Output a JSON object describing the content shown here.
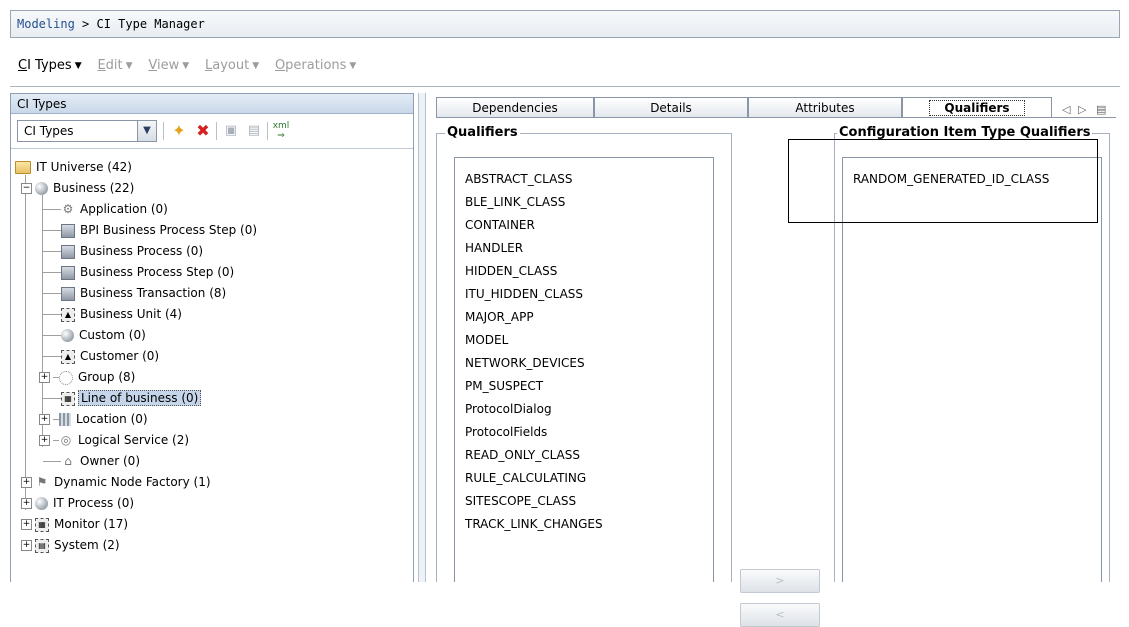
{
  "breadcrumb": {
    "root": "Modeling",
    "separator": " > ",
    "current": "CI Type Manager"
  },
  "menubar": [
    {
      "label_u": "C",
      "label_rest": "I Types",
      "state": "active"
    },
    {
      "label_u": "E",
      "label_rest": "dit",
      "state": "disabled"
    },
    {
      "label_u": "V",
      "label_rest": "iew",
      "state": "disabled"
    },
    {
      "label_u": "L",
      "label_rest": "ayout",
      "state": "disabled"
    },
    {
      "label_u": "O",
      "label_rest": "perations",
      "state": "disabled"
    }
  ],
  "left_panel": {
    "title": "CI Types",
    "select_value": "CI Types",
    "toolbar_icons": [
      "new-ci-type-icon",
      "delete-icon",
      "save-icon",
      "properties-icon",
      "export-xml-icon"
    ],
    "tree": [
      {
        "label": "IT Universe (42)",
        "icon": "folder-icon"
      },
      {
        "label": "Business (22)",
        "icon": "sphere-icon",
        "expander": "−"
      },
      {
        "label": "Application (0)",
        "icon": "gear-icon"
      },
      {
        "label": "BPI Business Process Step (0)",
        "icon": "process-step-icon"
      },
      {
        "label": "Business Process (0)",
        "icon": "document-icon"
      },
      {
        "label": "Business Process Step (0)",
        "icon": "process-step-icon"
      },
      {
        "label": "Business Transaction (8)",
        "icon": "transaction-icon"
      },
      {
        "label": "Business Unit (4)",
        "icon": "business-unit-icon"
      },
      {
        "label": "Custom (0)",
        "icon": "sphere-icon"
      },
      {
        "label": "Customer (0)",
        "icon": "customer-icon"
      },
      {
        "label": "Group (8)",
        "icon": "group-icon",
        "expander": "+"
      },
      {
        "label": "Line of business (0)",
        "icon": "line-of-business-icon",
        "selected": true
      },
      {
        "label": "Location (0)",
        "icon": "building-icon",
        "expander": "+"
      },
      {
        "label": "Logical Service (2)",
        "icon": "logical-service-icon",
        "expander": "+"
      },
      {
        "label": "Owner (0)",
        "icon": "owner-icon"
      },
      {
        "label": "Dynamic Node Factory (1)",
        "icon": "node-factory-icon",
        "expander": "+"
      },
      {
        "label": "IT Process (0)",
        "icon": "sphere-icon",
        "expander": "+"
      },
      {
        "label": "Monitor (17)",
        "icon": "monitor-icon",
        "expander": "+"
      },
      {
        "label": "System (2)",
        "icon": "system-icon",
        "expander": "+"
      }
    ]
  },
  "tabs": [
    "Dependencies",
    "Details",
    "Attributes",
    "Qualifiers"
  ],
  "active_tab": "Qualifiers",
  "qualifiers_group": {
    "title": "Qualifiers",
    "items": [
      "ABSTRACT_CLASS",
      "BLE_LINK_CLASS",
      "CONTAINER",
      "HANDLER",
      "HIDDEN_CLASS",
      "ITU_HIDDEN_CLASS",
      "MAJOR_APP",
      "MODEL",
      "NETWORK_DEVICES",
      "PM_SUSPECT",
      "ProtocolDialog",
      "ProtocolFields",
      "READ_ONLY_CLASS",
      "RULE_CALCULATING",
      "SITESCOPE_CLASS",
      "TRACK_LINK_CHANGES"
    ]
  },
  "move_buttons": [
    ">",
    "<"
  ],
  "ci_qualifiers_group": {
    "title": "Configuration Item Type Qualifiers",
    "items": [
      "RANDOM_GENERATED_ID_CLASS"
    ]
  }
}
